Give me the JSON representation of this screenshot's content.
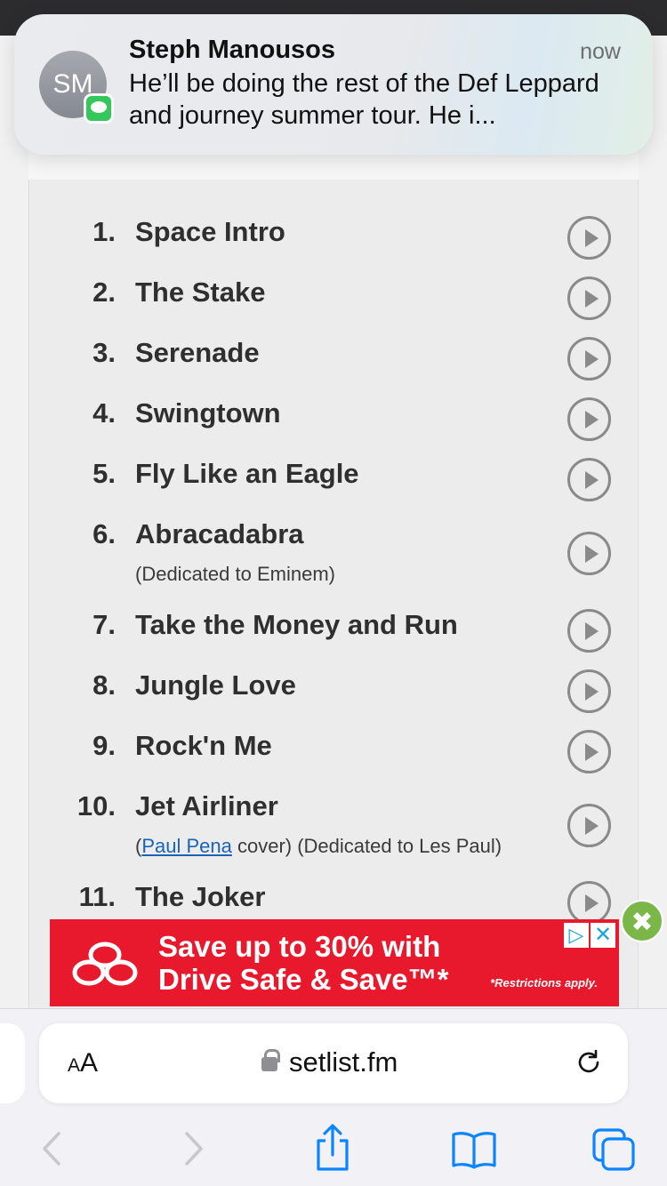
{
  "notification": {
    "avatar_initials": "SM",
    "sender": "Steph Manousos",
    "time": "now",
    "body": "He’ll be doing the rest of the Def Leppard and journey summer tour. He i..."
  },
  "setlist": [
    {
      "num": "1.",
      "title": "Space Intro",
      "note": ""
    },
    {
      "num": "2.",
      "title": "The Stake",
      "note": ""
    },
    {
      "num": "3.",
      "title": "Serenade",
      "note": ""
    },
    {
      "num": "4.",
      "title": "Swingtown",
      "note": ""
    },
    {
      "num": "5.",
      "title": "Fly Like an Eagle",
      "note": ""
    },
    {
      "num": "6.",
      "title": "Abracadabra",
      "note": "(Dedicated to Eminem)"
    },
    {
      "num": "7.",
      "title": "Take the Money and Run",
      "note": ""
    },
    {
      "num": "8.",
      "title": "Jungle Love",
      "note": ""
    },
    {
      "num": "9.",
      "title": "Rock'n Me",
      "note": ""
    },
    {
      "num": "10.",
      "title": "Jet Airliner",
      "note_pre": "(",
      "note_link": "Paul Pena",
      "note_post": " cover) (Dedicated to Les Paul)"
    },
    {
      "num": "11.",
      "title": "The Joker",
      "note": ""
    }
  ],
  "ad": {
    "line1": "Save up to 30% with",
    "line2": "Drive Safe & Save™*",
    "small": "*Restrictions apply.",
    "choices_icon": "ad-choices-icon",
    "close_x": "✕",
    "close_button": "✖",
    "brand_color": "#e8192c"
  },
  "browser": {
    "text_size_label_small": "A",
    "text_size_label_large": "A",
    "url": "setlist.fm"
  },
  "toolbar": {
    "icons": [
      "back-icon",
      "forward-icon",
      "share-icon",
      "bookmarks-icon",
      "tabs-icon"
    ],
    "accent_color": "#0a84ff"
  }
}
